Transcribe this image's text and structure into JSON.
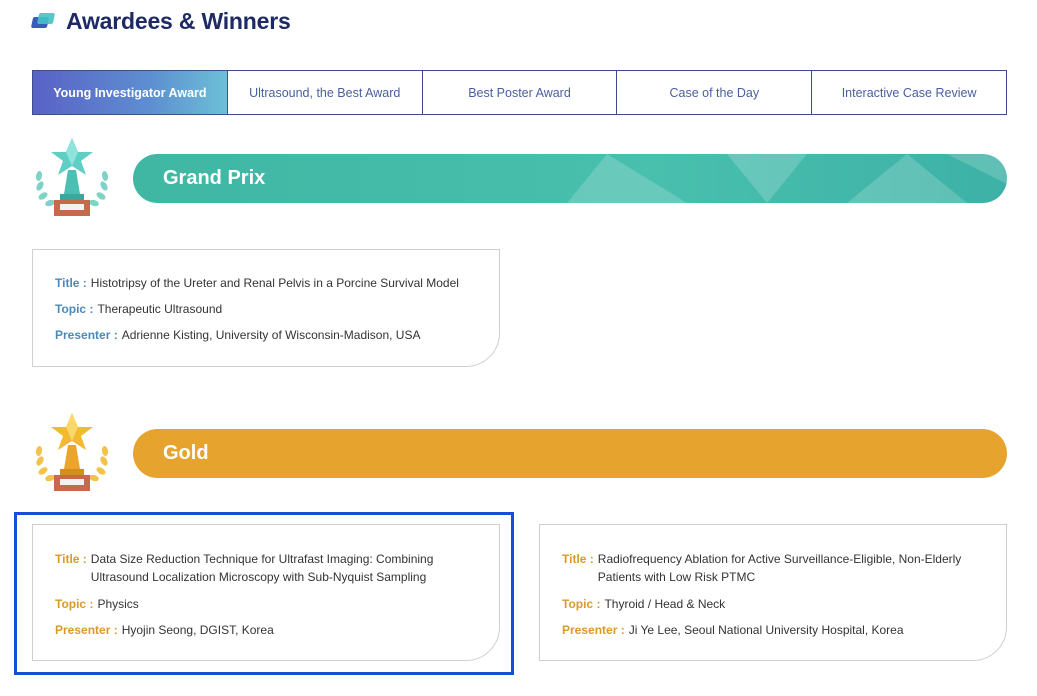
{
  "header": {
    "title": "Awardees & Winners",
    "icon": "cards-icon"
  },
  "tabs": [
    {
      "label": "Young Investigator Award",
      "active": true
    },
    {
      "label": "Ultrasound, the Best Award",
      "active": false
    },
    {
      "label": "Best Poster Award",
      "active": false
    },
    {
      "label": "Case of the Day",
      "active": false
    },
    {
      "label": "Interactive Case Review",
      "active": false
    }
  ],
  "sections": {
    "grand_prix": {
      "title": "Grand Prix",
      "color": "#45bba9",
      "icon": "teal-trophy-icon",
      "cards": [
        {
          "title_label": "Title :",
          "title": "Histotripsy of the Ureter and Renal Pelvis in a Porcine Survival Model",
          "topic_label": "Topic :",
          "topic": "Therapeutic Ultrasound",
          "presenter_label": "Presenter :",
          "presenter": "Adrienne Kisting, University of Wisconsin-Madison, USA"
        }
      ]
    },
    "gold": {
      "title": "Gold",
      "color": "#e6a42f",
      "icon": "gold-trophy-icon",
      "cards": [
        {
          "title_label": "Title :",
          "title_line1": "Data Size Reduction Technique for Ultrafast Imaging: Combining",
          "title_line2": "Ultrasound Localization Microscopy with Sub-Nyquist Sampling",
          "topic_label": "Topic :",
          "topic": "Physics",
          "presenter_label": "Presenter :",
          "presenter": "Hyojin Seong, DGIST, Korea"
        },
        {
          "title_label": "Title :",
          "title_line1": "Radiofrequency Ablation for Active Surveillance-Eligible, Non-Elderly",
          "title_line2": "Patients with Low Risk PTMC",
          "topic_label": "Topic :",
          "topic": "Thyroid / Head & Neck",
          "presenter_label": "Presenter :",
          "presenter": "Ji Ye Lee, Seoul National University Hospital, Korea"
        }
      ]
    }
  },
  "colors": {
    "accent_blue": "#1450d6",
    "navy": "#1d2a63",
    "teal": "#45bba9",
    "gold": "#e6a42f"
  }
}
